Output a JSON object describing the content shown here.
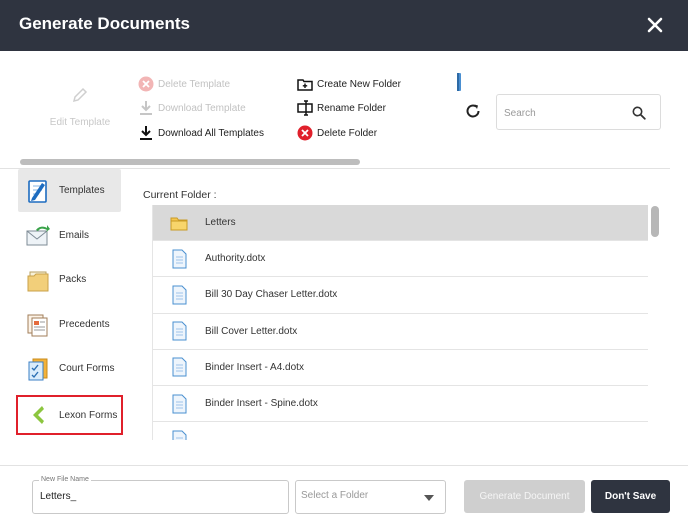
{
  "dialog": {
    "title": "Generate Documents"
  },
  "toolbar": {
    "edit_template": "Edit Template",
    "delete_template": "Delete Template",
    "download_template": "Download Template",
    "download_all": "Download All Templates",
    "create_folder": "Create New Folder",
    "rename_folder": "Rename Folder",
    "delete_folder": "Delete Folder"
  },
  "search": {
    "placeholder": "Search",
    "value": ""
  },
  "sidebar": {
    "items": [
      {
        "label": "Templates",
        "icon": "templates-icon"
      },
      {
        "label": "Emails",
        "icon": "emails-icon"
      },
      {
        "label": "Packs",
        "icon": "packs-icon"
      },
      {
        "label": "Precedents",
        "icon": "precedents-icon"
      },
      {
        "label": "Court Forms",
        "icon": "court-forms-icon"
      },
      {
        "label": "Lexon Forms",
        "icon": "lexon-forms-icon"
      }
    ]
  },
  "list": {
    "current_folder_label": "Current Folder :",
    "rows": [
      {
        "name": "Letters",
        "type": "folder"
      },
      {
        "name": "Authority.dotx",
        "type": "file"
      },
      {
        "name": "Bill 30 Day Chaser Letter.dotx",
        "type": "file"
      },
      {
        "name": "Bill Cover Letter.dotx",
        "type": "file"
      },
      {
        "name": "Binder Insert - A4.dotx",
        "type": "file"
      },
      {
        "name": "Binder Insert - Spine.dotx",
        "type": "file"
      },
      {
        "name": "",
        "type": "file"
      }
    ]
  },
  "footer": {
    "filename_label": "New File Name",
    "filename_value": "Letters_",
    "folder_placeholder": "Select a Folder",
    "generate_label": "Generate Document",
    "dont_save_label": "Don't Save"
  },
  "colors": {
    "header": "#2f3440",
    "highlight_border": "#e0202b",
    "delete_red": "#e0202b",
    "selected_row": "#d9d9d9"
  }
}
